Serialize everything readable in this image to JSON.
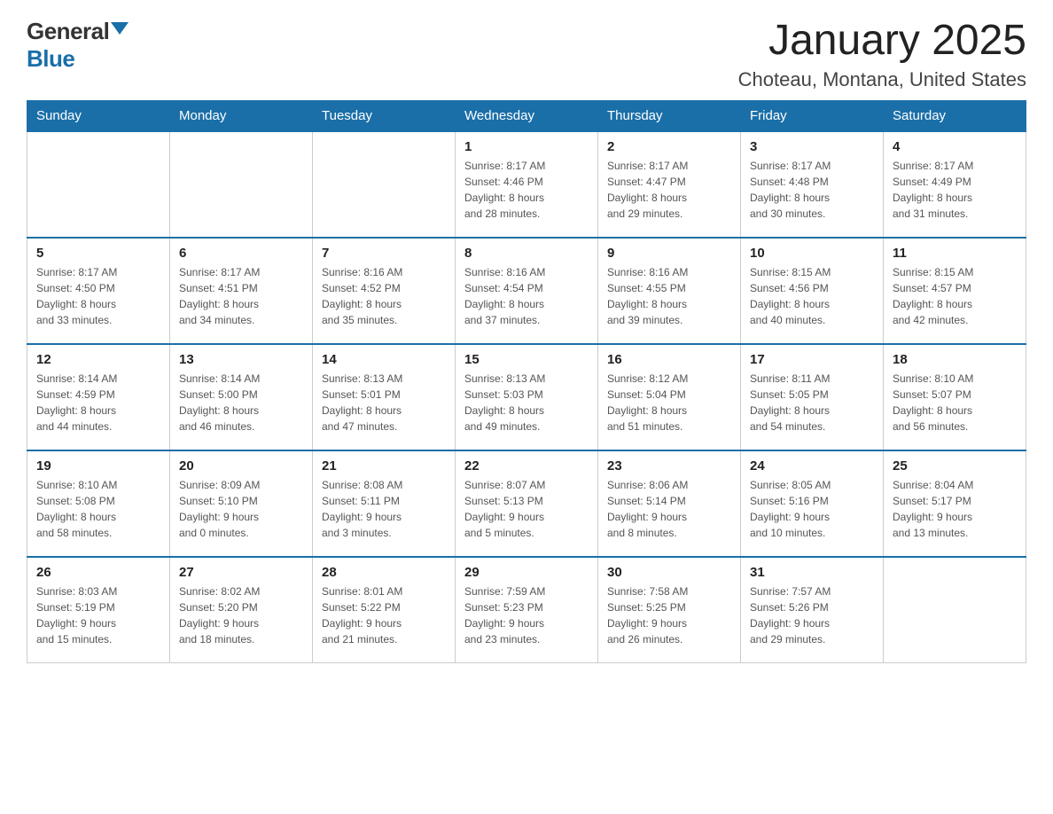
{
  "header": {
    "logo_general": "General",
    "logo_blue": "Blue",
    "calendar_title": "January 2025",
    "calendar_subtitle": "Choteau, Montana, United States"
  },
  "weekdays": [
    "Sunday",
    "Monday",
    "Tuesday",
    "Wednesday",
    "Thursday",
    "Friday",
    "Saturday"
  ],
  "weeks": [
    [
      {
        "day": "",
        "info": ""
      },
      {
        "day": "",
        "info": ""
      },
      {
        "day": "",
        "info": ""
      },
      {
        "day": "1",
        "info": "Sunrise: 8:17 AM\nSunset: 4:46 PM\nDaylight: 8 hours\nand 28 minutes."
      },
      {
        "day": "2",
        "info": "Sunrise: 8:17 AM\nSunset: 4:47 PM\nDaylight: 8 hours\nand 29 minutes."
      },
      {
        "day": "3",
        "info": "Sunrise: 8:17 AM\nSunset: 4:48 PM\nDaylight: 8 hours\nand 30 minutes."
      },
      {
        "day": "4",
        "info": "Sunrise: 8:17 AM\nSunset: 4:49 PM\nDaylight: 8 hours\nand 31 minutes."
      }
    ],
    [
      {
        "day": "5",
        "info": "Sunrise: 8:17 AM\nSunset: 4:50 PM\nDaylight: 8 hours\nand 33 minutes."
      },
      {
        "day": "6",
        "info": "Sunrise: 8:17 AM\nSunset: 4:51 PM\nDaylight: 8 hours\nand 34 minutes."
      },
      {
        "day": "7",
        "info": "Sunrise: 8:16 AM\nSunset: 4:52 PM\nDaylight: 8 hours\nand 35 minutes."
      },
      {
        "day": "8",
        "info": "Sunrise: 8:16 AM\nSunset: 4:54 PM\nDaylight: 8 hours\nand 37 minutes."
      },
      {
        "day": "9",
        "info": "Sunrise: 8:16 AM\nSunset: 4:55 PM\nDaylight: 8 hours\nand 39 minutes."
      },
      {
        "day": "10",
        "info": "Sunrise: 8:15 AM\nSunset: 4:56 PM\nDaylight: 8 hours\nand 40 minutes."
      },
      {
        "day": "11",
        "info": "Sunrise: 8:15 AM\nSunset: 4:57 PM\nDaylight: 8 hours\nand 42 minutes."
      }
    ],
    [
      {
        "day": "12",
        "info": "Sunrise: 8:14 AM\nSunset: 4:59 PM\nDaylight: 8 hours\nand 44 minutes."
      },
      {
        "day": "13",
        "info": "Sunrise: 8:14 AM\nSunset: 5:00 PM\nDaylight: 8 hours\nand 46 minutes."
      },
      {
        "day": "14",
        "info": "Sunrise: 8:13 AM\nSunset: 5:01 PM\nDaylight: 8 hours\nand 47 minutes."
      },
      {
        "day": "15",
        "info": "Sunrise: 8:13 AM\nSunset: 5:03 PM\nDaylight: 8 hours\nand 49 minutes."
      },
      {
        "day": "16",
        "info": "Sunrise: 8:12 AM\nSunset: 5:04 PM\nDaylight: 8 hours\nand 51 minutes."
      },
      {
        "day": "17",
        "info": "Sunrise: 8:11 AM\nSunset: 5:05 PM\nDaylight: 8 hours\nand 54 minutes."
      },
      {
        "day": "18",
        "info": "Sunrise: 8:10 AM\nSunset: 5:07 PM\nDaylight: 8 hours\nand 56 minutes."
      }
    ],
    [
      {
        "day": "19",
        "info": "Sunrise: 8:10 AM\nSunset: 5:08 PM\nDaylight: 8 hours\nand 58 minutes."
      },
      {
        "day": "20",
        "info": "Sunrise: 8:09 AM\nSunset: 5:10 PM\nDaylight: 9 hours\nand 0 minutes."
      },
      {
        "day": "21",
        "info": "Sunrise: 8:08 AM\nSunset: 5:11 PM\nDaylight: 9 hours\nand 3 minutes."
      },
      {
        "day": "22",
        "info": "Sunrise: 8:07 AM\nSunset: 5:13 PM\nDaylight: 9 hours\nand 5 minutes."
      },
      {
        "day": "23",
        "info": "Sunrise: 8:06 AM\nSunset: 5:14 PM\nDaylight: 9 hours\nand 8 minutes."
      },
      {
        "day": "24",
        "info": "Sunrise: 8:05 AM\nSunset: 5:16 PM\nDaylight: 9 hours\nand 10 minutes."
      },
      {
        "day": "25",
        "info": "Sunrise: 8:04 AM\nSunset: 5:17 PM\nDaylight: 9 hours\nand 13 minutes."
      }
    ],
    [
      {
        "day": "26",
        "info": "Sunrise: 8:03 AM\nSunset: 5:19 PM\nDaylight: 9 hours\nand 15 minutes."
      },
      {
        "day": "27",
        "info": "Sunrise: 8:02 AM\nSunset: 5:20 PM\nDaylight: 9 hours\nand 18 minutes."
      },
      {
        "day": "28",
        "info": "Sunrise: 8:01 AM\nSunset: 5:22 PM\nDaylight: 9 hours\nand 21 minutes."
      },
      {
        "day": "29",
        "info": "Sunrise: 7:59 AM\nSunset: 5:23 PM\nDaylight: 9 hours\nand 23 minutes."
      },
      {
        "day": "30",
        "info": "Sunrise: 7:58 AM\nSunset: 5:25 PM\nDaylight: 9 hours\nand 26 minutes."
      },
      {
        "day": "31",
        "info": "Sunrise: 7:57 AM\nSunset: 5:26 PM\nDaylight: 9 hours\nand 29 minutes."
      },
      {
        "day": "",
        "info": ""
      }
    ]
  ]
}
